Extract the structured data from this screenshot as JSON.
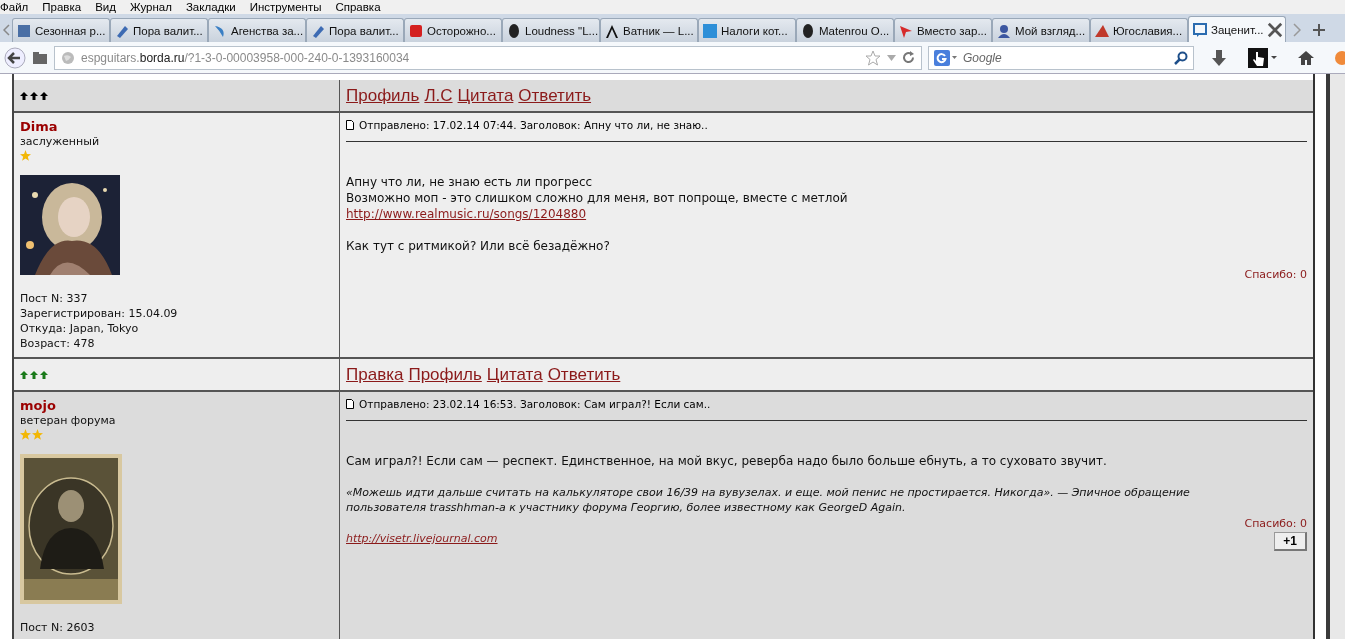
{
  "menu_bar": [
    "Файл",
    "Правка",
    "Вид",
    "Журнал",
    "Закладки",
    "Инструменты",
    "Справка"
  ],
  "tabs": [
    {
      "label": "Сезонная р...",
      "selected": false
    },
    {
      "label": "Пора валит...",
      "selected": false
    },
    {
      "label": "Агенства за...",
      "selected": false
    },
    {
      "label": "Пора валит...",
      "selected": false
    },
    {
      "label": "Осторожно...",
      "selected": false
    },
    {
      "label": "Loudness \"L...",
      "selected": false
    },
    {
      "label": "Ватник — L...",
      "selected": false
    },
    {
      "label": "Налоги кот...",
      "selected": false
    },
    {
      "label": "Matenrou O...",
      "selected": false
    },
    {
      "label": "Вместо зар...",
      "selected": false
    },
    {
      "label": "Мой взгляд...",
      "selected": false
    },
    {
      "label": "Югославия...",
      "selected": false
    },
    {
      "label": "Заценит...",
      "selected": true
    }
  ],
  "address_bar": {
    "url": "espguitars.**borda.ru**/?1-3-0-00003958-000-240-0-1393160034"
  },
  "search": {
    "placeholder": "Google"
  },
  "posts": [
    {
      "color": "#000000",
      "actions": [
        "Профиль",
        "Л.С",
        "Цитата",
        "Ответить"
      ],
      "author": "Dima",
      "rank": "заслуженный",
      "rank_icons": [
        {
          "kind": "star"
        }
      ],
      "info": [
        "Пост N: 337",
        "Зарегистрирован: 15.04.09",
        "Откуда: Japan, Tokyo",
        "Возраст: 478"
      ],
      "meta": "Отправлено: 17.02.14 07:44. Заголовок: Апну что ли, не знаю..",
      "paragraphs": [
        [
          {
            "kind": "text",
            "text": "Апну что ли, не знаю есть ли прогресс"
          },
          {
            "kind": "text",
            "text": "Возможно моп - это слишком сложно для меня, вот попроще, вместе с метлой"
          },
          {
            "kind": "link",
            "text": "http://www.realmusic.ru/songs/1204880"
          }
        ],
        [
          {
            "kind": "text",
            "text": "Как тут с ритмикой? Или всё безадёжно?"
          }
        ]
      ],
      "thanks": "Спасибо: 0"
    },
    {
      "color": "#1a7a1a",
      "actions": [
        "Правка",
        "Профиль",
        "Цитата",
        "Ответить"
      ],
      "author": "mojo",
      "rank": "ветеран форума",
      "rank_icons": [
        {
          "kind": "star"
        },
        {
          "kind": "star"
        }
      ],
      "info": [
        "Пост N: 2603"
      ],
      "meta": "Отправлено: 23.02.14 16:53. Заголовок: Сам играл?! Если сам..",
      "paragraphs": [
        [
          {
            "kind": "text",
            "text": "Сам играл?! Если сам — респект. Единственное, на мой вкус, реверба надо было больше ебнуть, а то суховато звучит."
          }
        ],
        [
          {
            "kind": "signature",
            "text": "«Можешь идти дальше считать на калькуляторе свои 16/39 на вувузелах. и еще. мой пенис не простирается. Никогда». — Эпичное обращение пользователя trasshhman-а к участнику форума Георгию, более известному как GeorgeD Again."
          }
        ],
        [
          {
            "kind": "signature_link",
            "text": "http://visetr.livejournal.com"
          }
        ]
      ],
      "thanks": "Спасибо: 0",
      "plus_button": "+1"
    }
  ]
}
